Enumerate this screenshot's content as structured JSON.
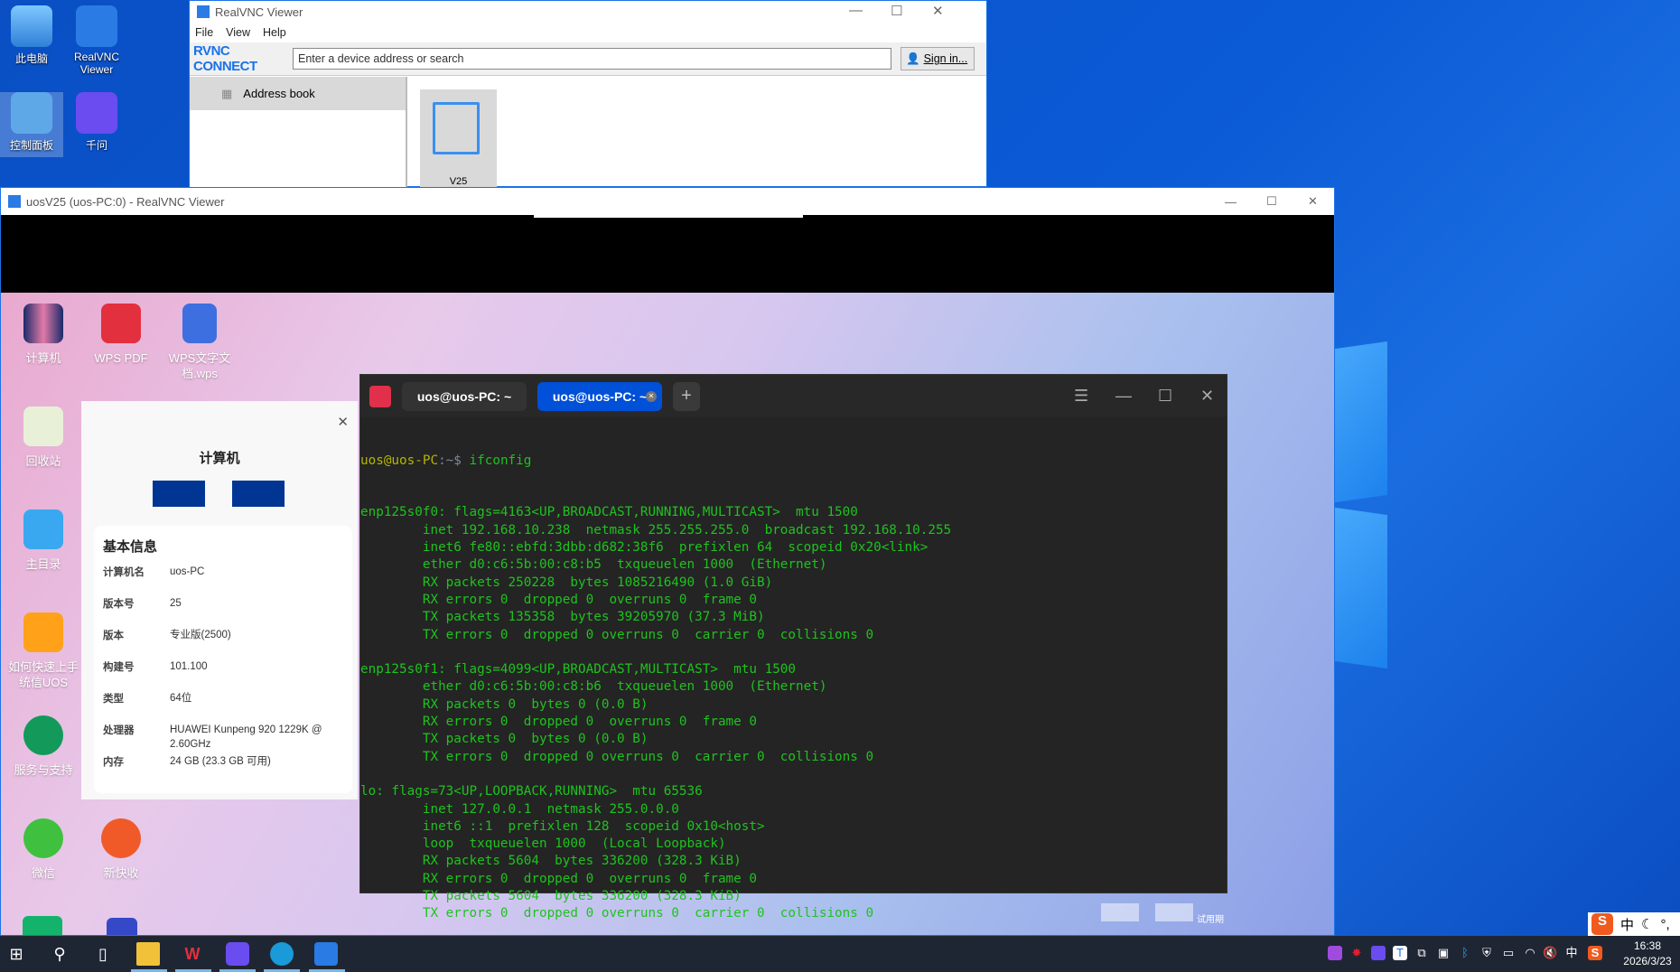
{
  "host_desktop": {
    "icons": [
      {
        "label": "此电脑"
      },
      {
        "label": "RealVNC Viewer"
      },
      {
        "label": "控制面板"
      },
      {
        "label": "千问"
      }
    ]
  },
  "vnc_main": {
    "title": "RealVNC Viewer",
    "menu": [
      "File",
      "View",
      "Help"
    ],
    "logo": "RVNC CONNECT",
    "search_placeholder": "Enter a device address or search",
    "sign_in": "Sign in...",
    "sidebar_item": "Address book",
    "device_label": "V25"
  },
  "session": {
    "title": "uosV25 (uos-PC:0) - RealVNC Viewer"
  },
  "remote_desktop": {
    "icons": [
      {
        "label": "计算机"
      },
      {
        "label": "WPS PDF"
      },
      {
        "label": "WPS文字文档.wps"
      },
      {
        "label": "回收站"
      },
      {
        "label": "主目录"
      },
      {
        "label": "如何快速上手统信UOS"
      },
      {
        "label": "服务与支持"
      },
      {
        "label": "微信"
      },
      {
        "label": "新快收"
      }
    ],
    "trial_label": "试用期"
  },
  "info_panel": {
    "title": "计算机",
    "section": "基本信息",
    "rows": [
      {
        "k": "计算机名",
        "v": "uos-PC"
      },
      {
        "k": "版本号",
        "v": "25"
      },
      {
        "k": "版本",
        "v": "专业版(2500)"
      },
      {
        "k": "构建号",
        "v": "101.100"
      },
      {
        "k": "类型",
        "v": "64位"
      },
      {
        "k": "处理器",
        "v": "HUAWEI Kunpeng 920 1229K @ 2.60GHz"
      },
      {
        "k": "内存",
        "v": "24 GB (23.3 GB 可用)"
      }
    ]
  },
  "terminal": {
    "tabs": [
      "uos@uos-PC: ~",
      "uos@uos-PC: ~"
    ],
    "prompt_user": "uos@uos-PC",
    "prompt_path": ":~$",
    "command": " ifconfig",
    "output": [
      "enp125s0f0: flags=4163<UP,BROADCAST,RUNNING,MULTICAST>  mtu 1500",
      "        inet 192.168.10.238  netmask 255.255.255.0  broadcast 192.168.10.255",
      "        inet6 fe80::ebfd:3dbb:d682:38f6  prefixlen 64  scopeid 0x20<link>",
      "        ether d0:c6:5b:00:c8:b5  txqueuelen 1000  (Ethernet)",
      "        RX packets 250228  bytes 1085216490 (1.0 GiB)",
      "        RX errors 0  dropped 0  overruns 0  frame 0",
      "        TX packets 135358  bytes 39205970 (37.3 MiB)",
      "        TX errors 0  dropped 0 overruns 0  carrier 0  collisions 0",
      "",
      "enp125s0f1: flags=4099<UP,BROADCAST,MULTICAST>  mtu 1500",
      "        ether d0:c6:5b:00:c8:b6  txqueuelen 1000  (Ethernet)",
      "        RX packets 0  bytes 0 (0.0 B)",
      "        RX errors 0  dropped 0  overruns 0  frame 0",
      "        TX packets 0  bytes 0 (0.0 B)",
      "        TX errors 0  dropped 0 overruns 0  carrier 0  collisions 0",
      "",
      "lo: flags=73<UP,LOOPBACK,RUNNING>  mtu 65536",
      "        inet 127.0.0.1  netmask 255.0.0.0",
      "        inet6 ::1  prefixlen 128  scopeid 0x10<host>",
      "        loop  txqueuelen 1000  (Local Loopback)",
      "        RX packets 5604  bytes 336200 (328.3 KiB)",
      "        RX errors 0  dropped 0  overruns 0  frame 0",
      "        TX packets 5604  bytes 336200 (328.3 KiB)",
      "        TX errors 0  dropped 0 overruns 0  carrier 0  collisions 0",
      ""
    ]
  },
  "ime": {
    "label": "中",
    "punct": "°,"
  },
  "taskbar": {
    "tray_lang": "中",
    "time": "16:38",
    "date": "2026/3/23"
  },
  "colors": {
    "term_green": "#1fc21f",
    "prompt": "#b5b500",
    "tab_active": "#0050d8",
    "taskbar": "#1f2633"
  }
}
